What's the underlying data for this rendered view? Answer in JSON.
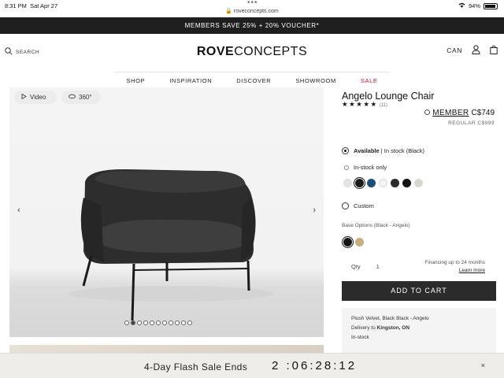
{
  "status_bar": {
    "time": "8:31 PM",
    "date": "Sat Apr 27",
    "url": "roveconcepts.com",
    "battery": "94%"
  },
  "promo": {
    "text": "MEMBERS SAVE 25% + 20% VOUCHER*"
  },
  "header": {
    "search_label": "SEARCH",
    "logo_bold": "ROVE",
    "logo_light": "CONCEPTS",
    "currency": "CAN"
  },
  "nav": [
    "SHOP",
    "INSPIRATION",
    "DISCOVER",
    "SHOWROOM",
    "SALE"
  ],
  "gallery": {
    "video_label": "Video",
    "view360_label": "360°",
    "slide_count": 11,
    "active_slide": 1
  },
  "product": {
    "title": "Angelo Lounge Chair",
    "stars": "★★★★★",
    "review_count": "(11)",
    "member_label": "MEMBER",
    "member_price": "C$749",
    "regular_price": "REGULAR C$999",
    "available_label": "Available",
    "available_detail": "| In stock (Black)",
    "instock_only_label": "In-stock only",
    "fabric_colors": [
      "#e4e4e4",
      "#1a1a1a",
      "#1f4e79",
      "#f3f3f3",
      "#2a2a2a",
      "#141414",
      "#d8d6cf"
    ],
    "custom_label": "Custom",
    "base_options_label": "Base Options (Black - Angelo)",
    "base_colors": [
      "#151515",
      "#c8ad82"
    ],
    "qty_label": "Qty",
    "qty_value": "1",
    "financing_text": "Financing up to 24 months",
    "learn_more": "Learn more",
    "add_to_cart": "ADD TO CART",
    "info_line1": "Plush Velvet, Black Black - Angelo",
    "info_line2_prefix": "Delivery to ",
    "info_line2_city": "Kingston, ON",
    "info_line3": "In-stock"
  },
  "flash_sale": {
    "text": "4-Day Flash Sale Ends",
    "countdown": "2 :06:28:12",
    "close": "×"
  },
  "colors": {
    "accent_dark": "#2b2b2b",
    "sale_red": "#c8102e"
  }
}
